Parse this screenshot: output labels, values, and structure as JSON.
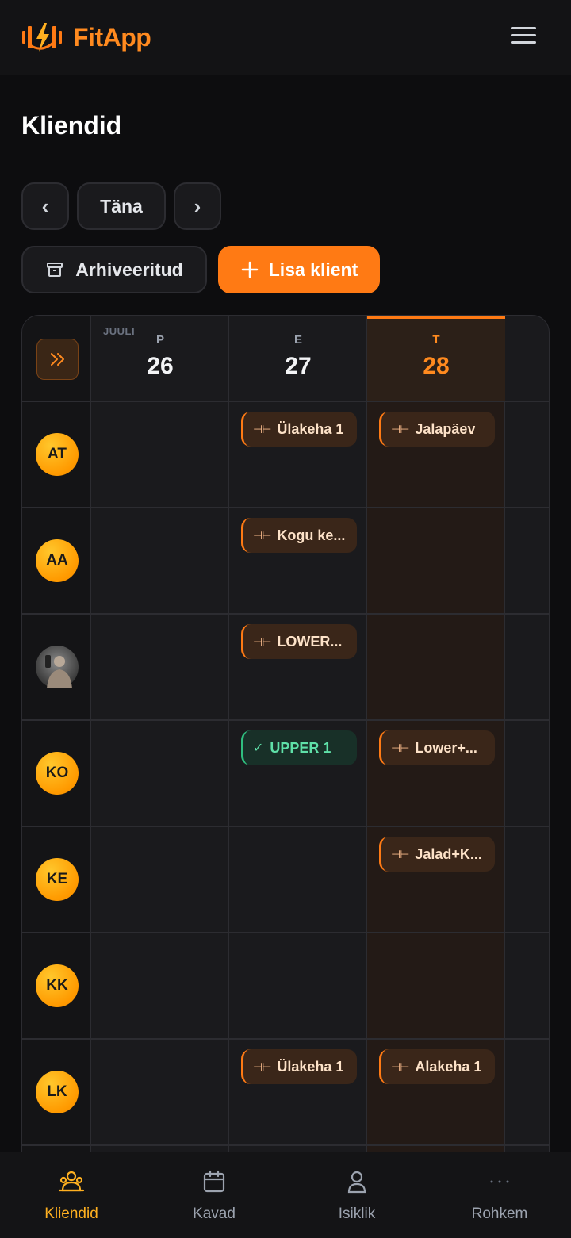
{
  "app": {
    "name": "FitApp"
  },
  "page": {
    "title": "Kliendid"
  },
  "nav": {
    "prev": "‹",
    "today": "Täna",
    "next": "›"
  },
  "actions": {
    "archived": "Arhiveeritud",
    "add_client": "Lisa klient"
  },
  "calendar": {
    "month": "JUULI",
    "days": [
      {
        "letter": "P",
        "num": "26"
      },
      {
        "letter": "E",
        "num": "27"
      },
      {
        "letter": "T",
        "num": "28"
      }
    ],
    "rows": [
      {
        "initials": "AT",
        "sessions": {
          "d1": "Ülakeha 1",
          "d2": "Jalapäev"
        }
      },
      {
        "initials": "AA",
        "sessions": {
          "d1": "Kogu ke..."
        }
      },
      {
        "initials": "",
        "sessions": {
          "d1": "LOWER..."
        }
      },
      {
        "initials": "KO",
        "sessions": {
          "d1": "UPPER 1",
          "d2": "Lower+..."
        }
      },
      {
        "initials": "KE",
        "sessions": {
          "d2": "Jalad+K..."
        }
      },
      {
        "initials": "KK",
        "sessions": {}
      },
      {
        "initials": "LK",
        "sessions": {
          "d1": "Ülakeha 1",
          "d2": "Alakeha 1"
        }
      }
    ]
  },
  "bottom_nav": [
    {
      "label": "Kliendid",
      "icon": "clients-icon",
      "active": true
    },
    {
      "label": "Kavad",
      "icon": "calendar-icon"
    },
    {
      "label": "Isiklik",
      "icon": "user-icon"
    },
    {
      "label": "Rohkem",
      "icon": "more-icon"
    }
  ],
  "colors": {
    "accent": "#ff7a14",
    "done": "#2fbf7f",
    "active_nav": "#ffb020"
  }
}
